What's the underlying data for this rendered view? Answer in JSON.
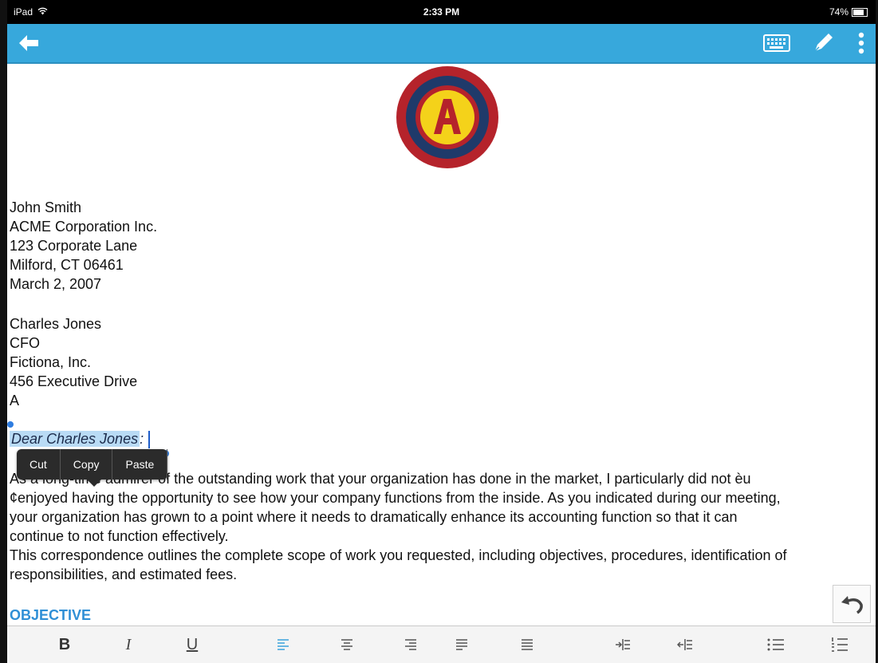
{
  "status_bar": {
    "device": "iPad",
    "time": "2:33 PM",
    "battery": "74%",
    "battery_level": 0.74
  },
  "app_bar": {
    "back_icon": "back-arrow-icon",
    "keyboard_icon": "keyboard-icon",
    "pen_icon": "pen-icon",
    "more_icon": "more-vertical-icon"
  },
  "logo": {
    "letter": "A",
    "colors": {
      "outer": "#b5232b",
      "ring": "#1f3a6a",
      "inner": "#b5232b",
      "letter_bg": "#f4d21a"
    }
  },
  "sender": [
    "John Smith",
    "ACME Corporation Inc.",
    "123 Corporate Lane",
    "Milford, CT 06461",
    "March 2, 2007"
  ],
  "recipient": [
    "Charles Jones",
    "CFO",
    "Fictiona, Inc.",
    "456 Executive Drive"
  ],
  "recipient_hidden_fragment": "A",
  "greeting": {
    "text": "Dear Charles Jones",
    "suffix": ":"
  },
  "context_menu": {
    "cut": "Cut",
    "copy": "Copy",
    "paste": "Paste"
  },
  "body": [
    "As a long-time admirer of the outstanding work that your organization has done in the market, I particularly did not èu",
    "¢enjoyed having the opportunity to see how your company functions from the inside. As you indicated during our meeting,",
    "your organization has grown to a point where it needs to dramatically enhance its accounting function so that it can",
    "continue to not function effectively.",
    "This correspondence outlines the complete scope of work you requested, including objectives, procedures, identification of",
    "responsibilities, and estimated fees."
  ],
  "objective_heading": "OBJECTIVE",
  "toolbar": {
    "bold": "B",
    "italic": "I",
    "underline": "U",
    "icons": [
      "align-left-icon",
      "align-center-icon",
      "align-right-icon",
      "align-justify-icon",
      "align-distributed-icon",
      "indent-increase-icon",
      "indent-decrease-icon",
      "bullet-list-icon",
      "numbered-list-icon"
    ]
  },
  "undo_icon": "undo-icon"
}
